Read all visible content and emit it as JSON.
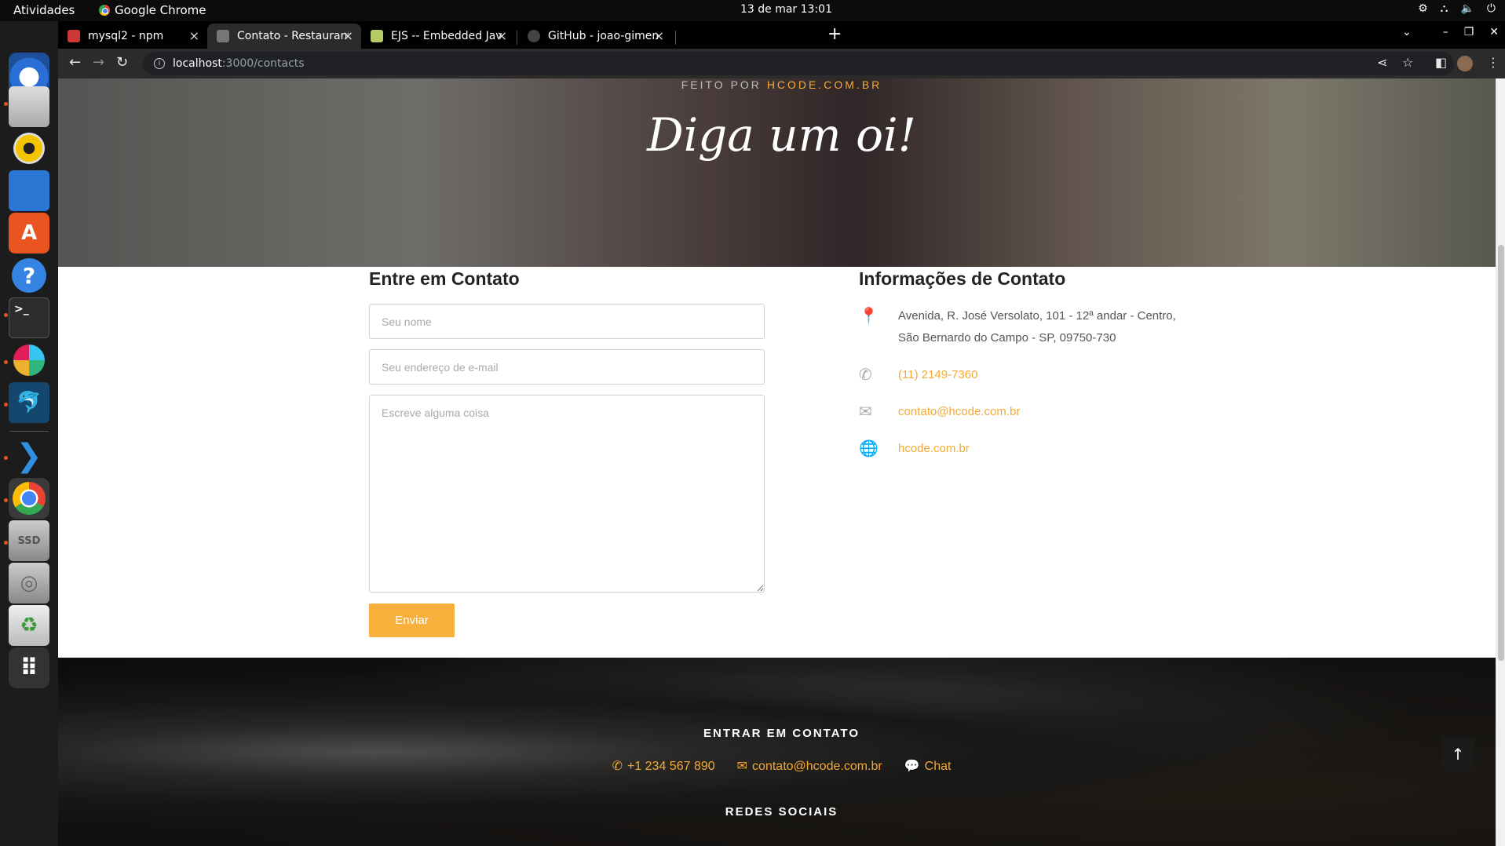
{
  "system_bar": {
    "activities": "Atividades",
    "app_name": "Google Chrome",
    "clock": "13 de mar  13:01"
  },
  "tabs": [
    {
      "title": "mysql2 - npm",
      "favicon_color": "#cb3837"
    },
    {
      "title": "Contato - Restaurante Sal",
      "favicon_color": "#777777"
    },
    {
      "title": "EJS -- Embedded JavaScri",
      "favicon_color": "#b4ca65"
    },
    {
      "title": "GitHub - joao-gimenes-cle",
      "favicon_color": "#444444"
    }
  ],
  "address_bar": {
    "host": "localhost",
    "path": ":3000/contacts"
  },
  "hero": {
    "made_by_prefix": "FEITO POR ",
    "made_by_link": "HCODE.COM.BR",
    "title": "Diga um oi!"
  },
  "form": {
    "title": "Entre em Contato",
    "name_placeholder": "Seu nome",
    "email_placeholder": "Seu endereço de e-mail",
    "message_placeholder": "Escreve alguma coisa",
    "submit_label": "Enviar"
  },
  "contact_info": {
    "title": "Informações de Contato",
    "address_line1": "Avenida, R. José Versolato, 101 - 12ª andar - Centro,",
    "address_line2": "São Bernardo do Campo - SP, 09750-730",
    "phone": "(11) 2149-7360",
    "email": "contato@hcode.com.br",
    "website": "hcode.com.br"
  },
  "footer": {
    "contact_title": "ENTRAR EM CONTATO",
    "phone": "+1 234 567 890",
    "email": "contato@hcode.com.br",
    "chat": "Chat",
    "social_title": "REDES SOCIAIS"
  },
  "colors": {
    "accent": "#f4a933",
    "button": "#f7b03c"
  }
}
